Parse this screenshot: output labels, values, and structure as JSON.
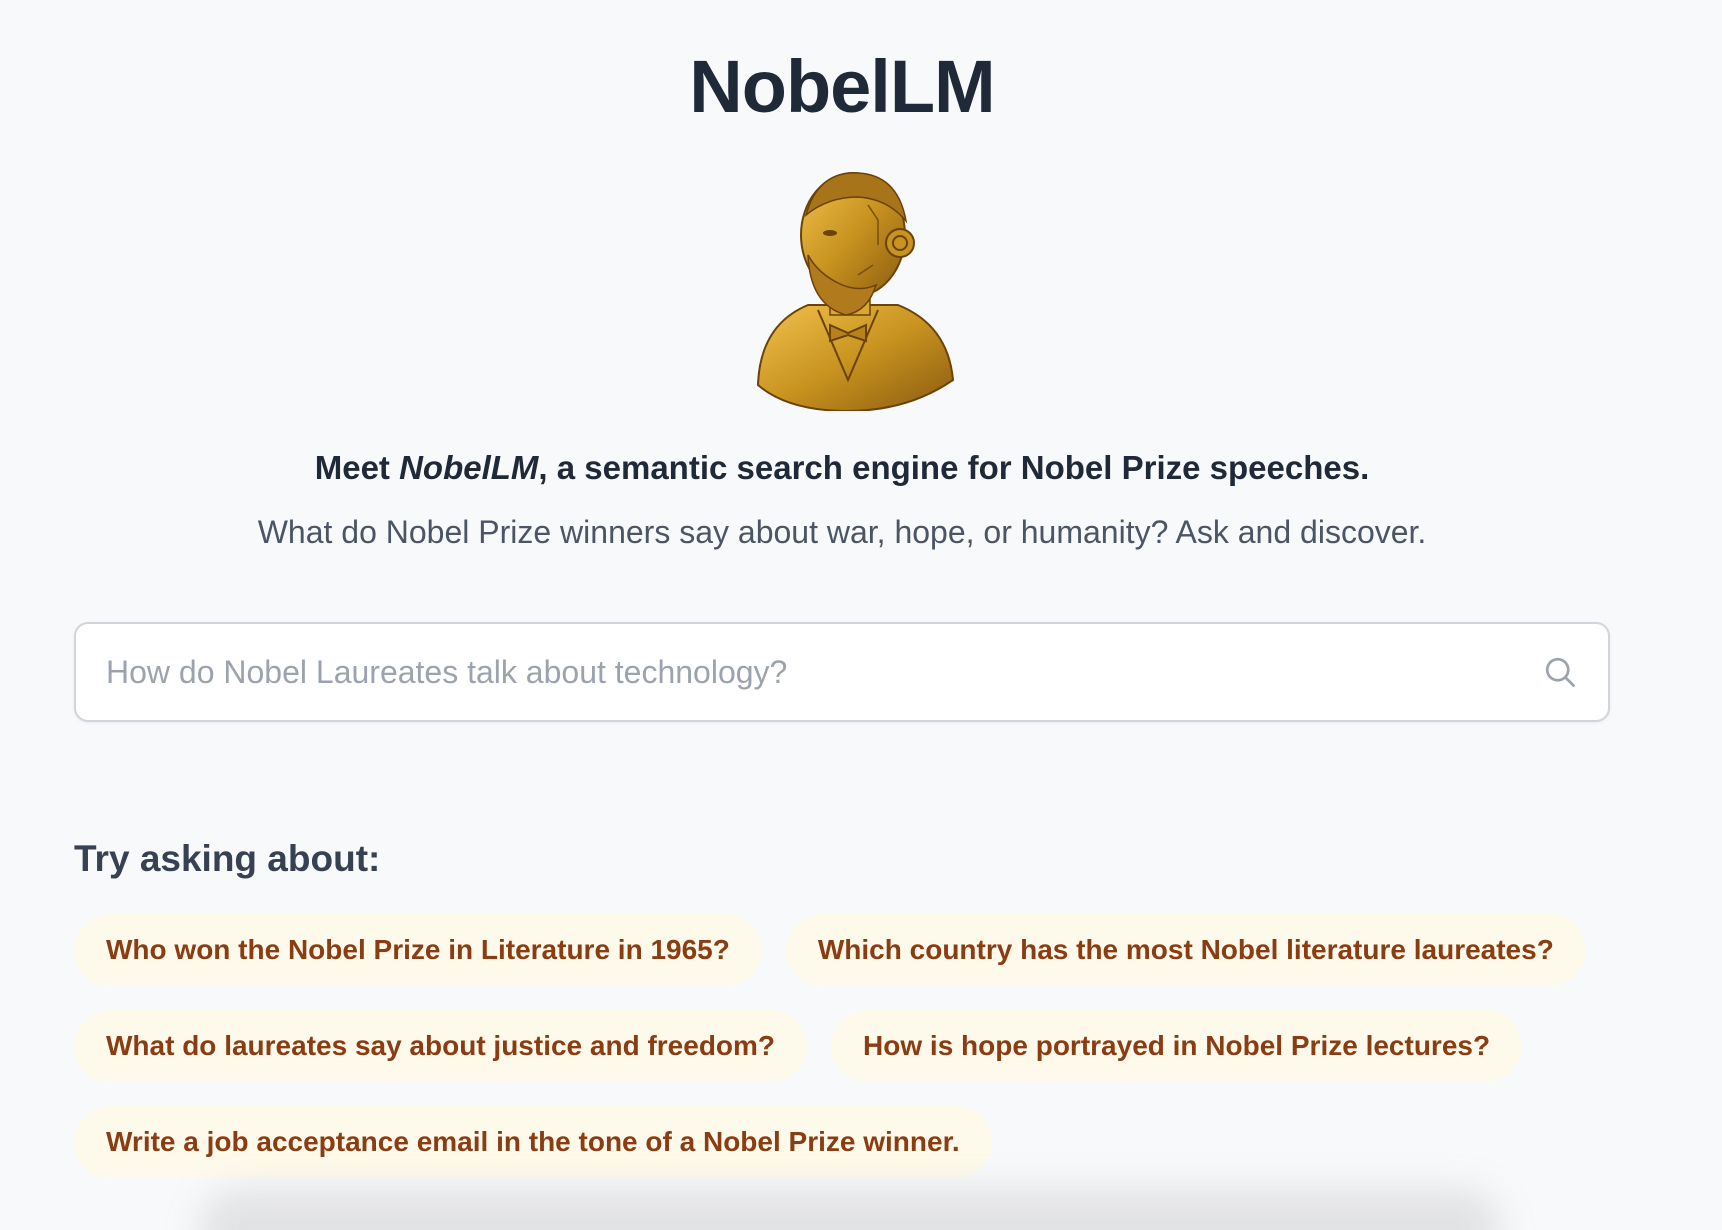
{
  "app": {
    "title": "NobelLM"
  },
  "hero": {
    "tagline_prefix": "Meet ",
    "tagline_brand": "NobelLM",
    "tagline_suffix": ", a semantic search engine for Nobel Prize speeches.",
    "subtitle": "What do Nobel Prize winners say about war, hope, or humanity? Ask and discover."
  },
  "search": {
    "placeholder": "How do Nobel Laureates talk about technology?",
    "value": "",
    "icon": "search-icon"
  },
  "suggestions": {
    "heading": "Try asking about:",
    "items": [
      "Who won the Nobel Prize in Literature in 1965?",
      "Which country has the most Nobel literature laureates?",
      "What do laureates say about justice and freedom?",
      "How is hope portrayed in Nobel Prize lectures?",
      "Write a job acceptance email in the tone of a Nobel Prize winner."
    ]
  },
  "colors": {
    "background": "#f8f9fb",
    "title": "#1f2937",
    "chip_bg": "#fefaeb",
    "chip_text": "#8a3c13",
    "logo_gold": "#c8931f"
  }
}
